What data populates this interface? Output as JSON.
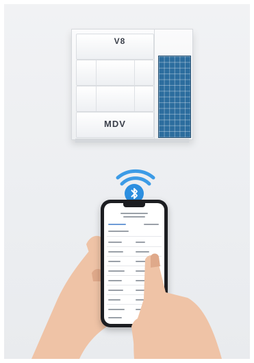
{
  "unit": {
    "model_label": "V8",
    "brand_label": "MDV"
  },
  "icons": {
    "wireless": "wifi-signal-icon",
    "bluetooth": "bluetooth-icon",
    "bluetooth_glyph": "ʙ"
  },
  "colors": {
    "accent": "#2d8fe0",
    "solar_panel": "#2c6d9e",
    "phone_body": "#1c1d21"
  }
}
